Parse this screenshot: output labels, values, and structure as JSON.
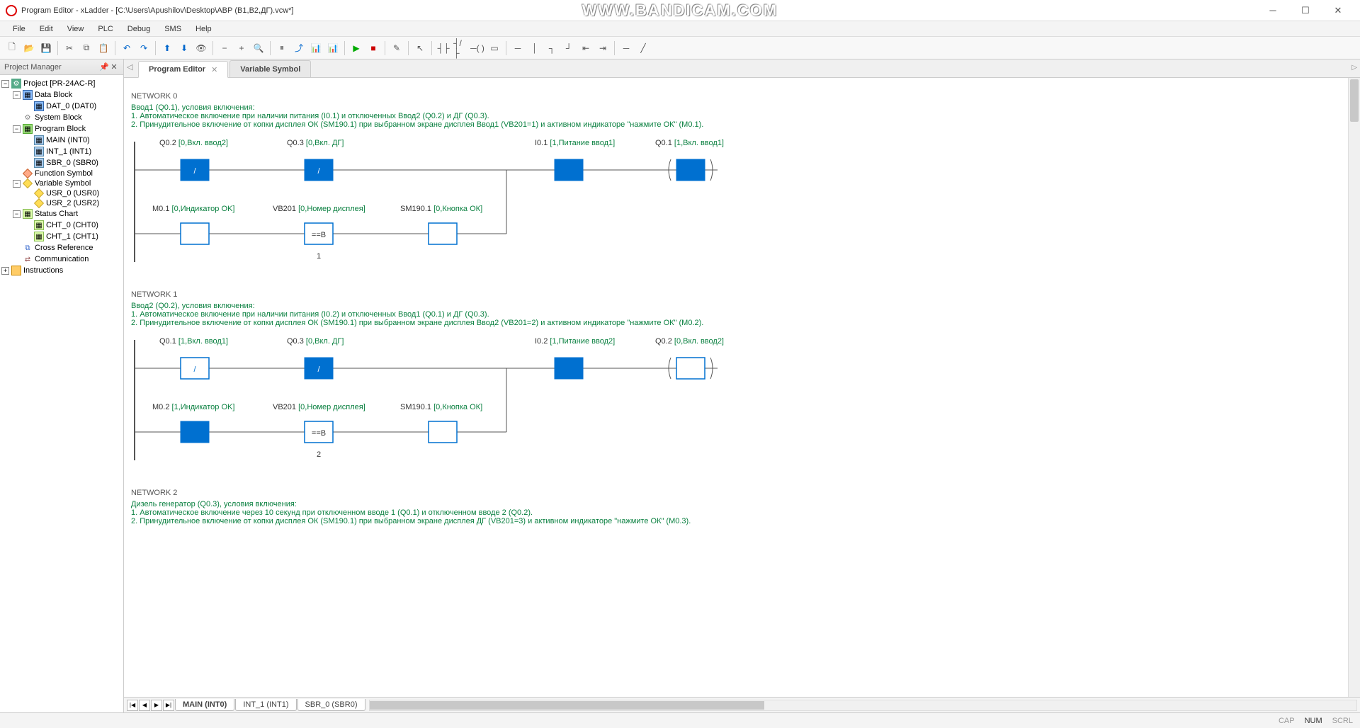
{
  "window": {
    "title": "Program Editor - xLadder - [C:\\Users\\Apushilov\\Desktop\\АВР (В1,В2,ДГ).vcw*]",
    "watermark": "WWW.BANDICAM.COM",
    "min": "─",
    "max": "☐",
    "close": "✕"
  },
  "menu": {
    "file": "File",
    "edit": "Edit",
    "view": "View",
    "plc": "PLC",
    "debug": "Debug",
    "sms": "SMS",
    "help": "Help"
  },
  "toolbar_icons": {
    "new": "🗋",
    "open": "📂",
    "save": "💾",
    "cut": "✂",
    "copy": "⧉",
    "paste": "📋",
    "undo": "↶",
    "redo": "↷",
    "upload": "⬆",
    "download": "⬇",
    "monitor": "👁",
    "zoom": "🔍",
    "zoom_in": "+",
    "zoom_out": "−",
    "pause": "⏸",
    "chart": "📊",
    "run": "▶",
    "stop": "■",
    "edit": "✎",
    "select": "↖",
    "contact_no": "┤├",
    "contact_nc": "┤/├",
    "coil": "─( )",
    "box": "▭",
    "line_h": "─",
    "line_v": "│",
    "branch_d": "┐",
    "branch_u": "┘",
    "del_h": "⇤",
    "del_v": "⇥"
  },
  "sidebar": {
    "title": "Project Manager",
    "pin": "📌",
    "close": "✕",
    "tree": {
      "project": "Project [PR-24AC-R]",
      "data_block": "Data Block",
      "dat0": "DAT_0 (DAT0)",
      "system_block": "System Block",
      "program_block": "Program Block",
      "main": "MAIN (INT0)",
      "int1": "INT_1 (INT1)",
      "sbr0": "SBR_0 (SBR0)",
      "function_symbol": "Function Symbol",
      "variable_symbol": "Variable Symbol",
      "usr0": "USR_0 (USR0)",
      "usr2": "USR_2 (USR2)",
      "status_chart": "Status Chart",
      "cht0": "CHT_0 (CHT0)",
      "cht1": "CHT_1 (CHT1)",
      "cross_reference": "Cross Reference",
      "communication": "Communication",
      "instructions": "Instructions"
    }
  },
  "tabs": {
    "program_editor": "Program Editor",
    "variable_symbol": "Variable Symbol"
  },
  "networks": [
    {
      "title": "NETWORK 0",
      "comment": "Ввод1 (Q0.1), условия включения:\n1. Автоматическое включение при наличии питания (I0.1) и отключенных Ввод2 (Q0.2) и ДГ (Q0.3).\n2. Принудительное включение от копки дисплея ОК (SM190.1) при выбранном экране дисплея Ввод1 (VB201=1) и активном индикаторе \"нажмите ОК\" (M0.1).",
      "r1": {
        "c1": {
          "addr": "Q0.2",
          "sym": "[0,Вкл. ввод2]",
          "type": "nc",
          "filled": true
        },
        "c2": {
          "addr": "Q0.3",
          "sym": "[0,Вкл. ДГ]",
          "type": "nc",
          "filled": true
        },
        "c3": {
          "addr": "I0.1",
          "sym": "[1,Питание ввод1]",
          "type": "no",
          "filled": true
        },
        "c4": {
          "addr": "Q0.1",
          "sym": "[1,Вкл. ввод1]",
          "type": "coil",
          "filled": true
        }
      },
      "r2": {
        "c1": {
          "addr": "M0.1",
          "sym": "[0,Индикатор OK]",
          "type": "no",
          "filled": false
        },
        "c2": {
          "addr": "VB201",
          "sym": "[0,Номер дисплея]",
          "type": "cmp",
          "txt": "==B",
          "val": "1"
        },
        "c3": {
          "addr": "SM190.1",
          "sym": "[0,Кнопка ОК]",
          "type": "no",
          "filled": false
        }
      }
    },
    {
      "title": "NETWORK 1",
      "comment": "Ввод2 (Q0.2), условия включения:\n1. Автоматическое включение при наличии питания (I0.2) и отключенных Ввод1 (Q0.1) и ДГ (Q0.3).\n2. Принудительное включение от копки дисплея ОК (SM190.1) при выбранном экране дисплея Ввод2 (VB201=2) и активном индикаторе \"нажмите ОК\" (M0.2).",
      "r1": {
        "c1": {
          "addr": "Q0.1",
          "sym": "[1,Вкл. ввод1]",
          "type": "nc",
          "filled": false
        },
        "c2": {
          "addr": "Q0.3",
          "sym": "[0,Вкл. ДГ]",
          "type": "nc",
          "filled": true
        },
        "c3": {
          "addr": "I0.2",
          "sym": "[1,Питание ввод2]",
          "type": "no",
          "filled": true
        },
        "c4": {
          "addr": "Q0.2",
          "sym": "[0,Вкл. ввод2]",
          "type": "coil",
          "filled": false
        }
      },
      "r2": {
        "c1": {
          "addr": "M0.2",
          "sym": "[1,Индикатор OK]",
          "type": "no",
          "filled": true
        },
        "c2": {
          "addr": "VB201",
          "sym": "[0,Номер дисплея]",
          "type": "cmp",
          "txt": "==B",
          "val": "2"
        },
        "c3": {
          "addr": "SM190.1",
          "sym": "[0,Кнопка ОК]",
          "type": "no",
          "filled": false
        }
      }
    },
    {
      "title": "NETWORK 2",
      "comment": "Дизель генератор (Q0.3), условия включения:\n1. Автоматическое включение через 10 секунд при отключенном вводе 1 (Q0.1) и отключенном вводе 2 (Q0.2).\n2. Принудительное включение от копки дисплея ОК (SM190.1) при выбранном экране дисплея ДГ (VB201=3) и активном индикаторе \"нажмите ОК\" (M0.3)."
    }
  ],
  "bottom_tabs": {
    "main": "MAIN (INT0)",
    "int1": "INT_1 (INT1)",
    "sbr0": "SBR_0 (SBR0)"
  },
  "status": {
    "cap": "CAP",
    "num": "NUM",
    "scrl": "SCRL"
  }
}
